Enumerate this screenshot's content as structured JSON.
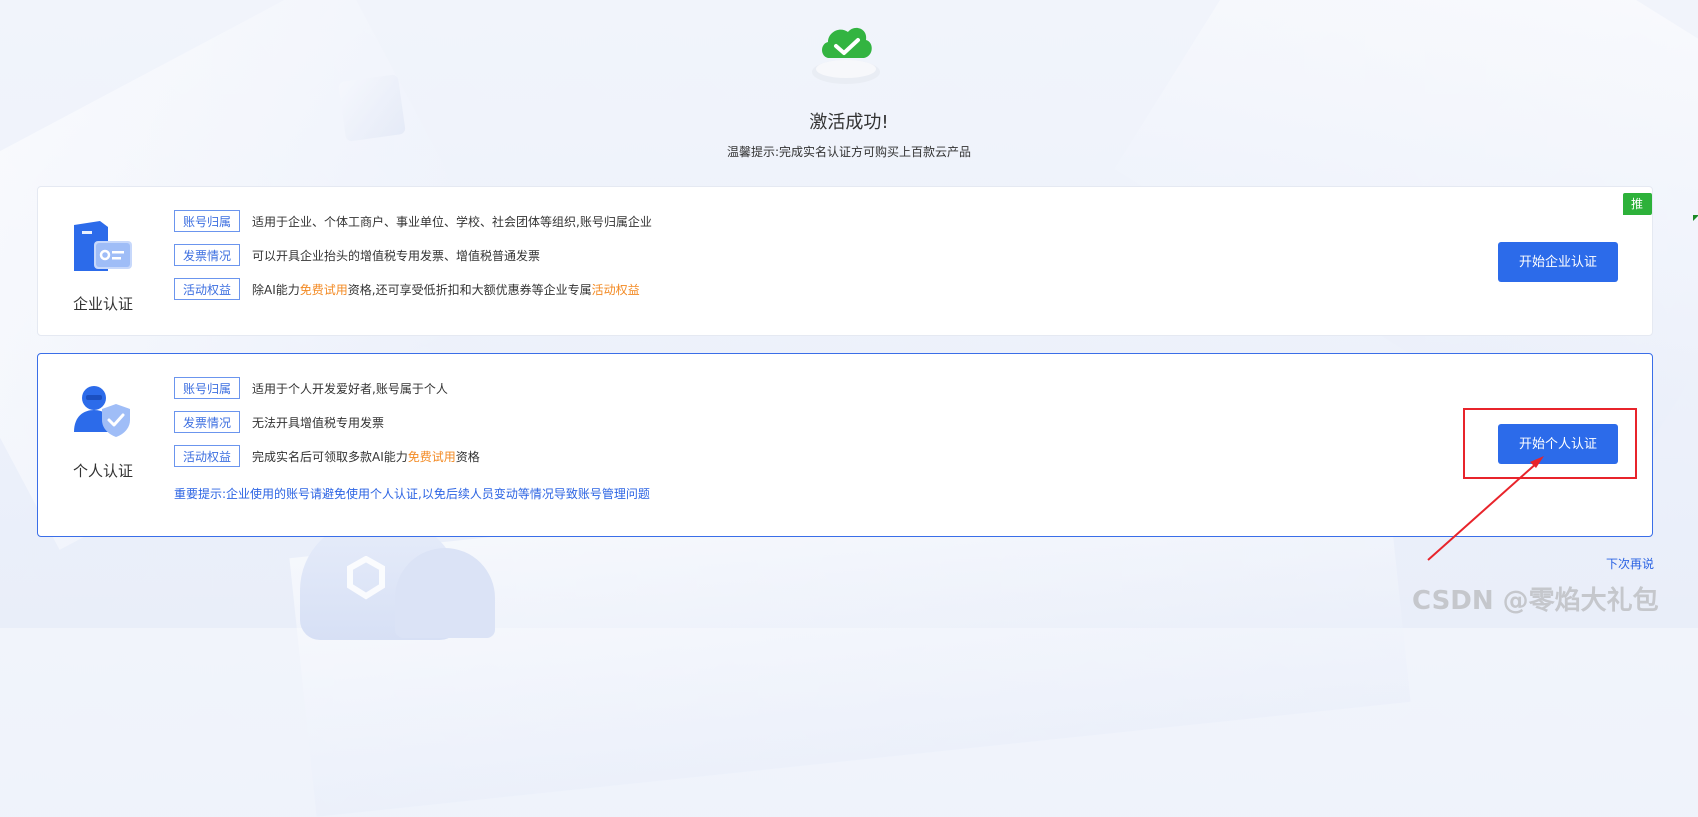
{
  "header": {
    "title": "激活成功!",
    "tip": "温馨提示:完成实名认证方可购买上百款云产品"
  },
  "enterprise": {
    "title": "企业认证",
    "badge": "推荐",
    "rows": [
      {
        "tag": "账号归属",
        "text": "适用于企业、个体工商户、事业单位、学校、社会团体等组织,账号归属企业"
      },
      {
        "tag": "发票情况",
        "text": "可以开具企业抬头的增值税专用发票、增值税普通发票"
      },
      {
        "tag": "活动权益",
        "text_a": "除AI能力",
        "hl1": "免费试用",
        "text_b": "资格,还可享受低折扣和大额优惠券等企业专属",
        "hl2": "活动权益"
      }
    ],
    "button": "开始企业认证"
  },
  "personal": {
    "title": "个人认证",
    "rows": [
      {
        "tag": "账号归属",
        "text": "适用于个人开发爱好者,账号属于个人"
      },
      {
        "tag": "发票情况",
        "text": "无法开具增值税专用发票"
      },
      {
        "tag": "活动权益",
        "text_a": "完成实名后可领取多款AI能力",
        "hl1": "免费试用",
        "text_b": "资格"
      }
    ],
    "important": "重要提示:企业使用的账号请避免使用个人认证,以免后续人员变动等情况导致账号管理问题",
    "button": "开始个人认证"
  },
  "footer": {
    "later": "下次再说",
    "watermark": "CSDN @零焰大礼包"
  },
  "colors": {
    "primary": "#2c6bea",
    "highlight": "#f38a23",
    "badge": "#2db13a",
    "annotation": "#e8242b"
  }
}
